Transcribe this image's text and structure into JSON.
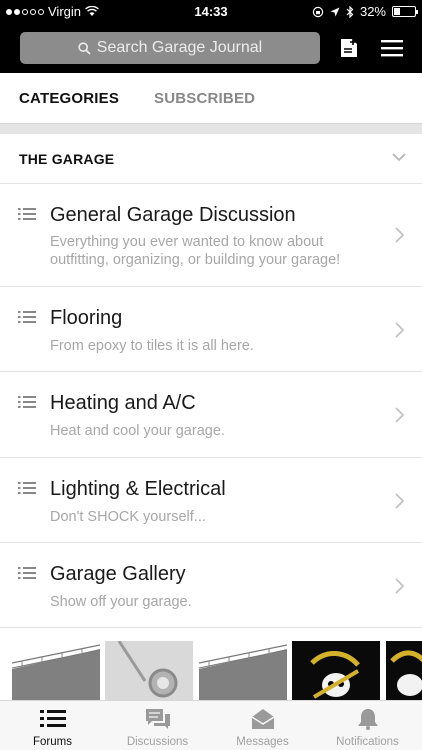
{
  "status_bar": {
    "carrier": "Virgin",
    "time": "14:33",
    "battery_percent": "32%",
    "battery_level": 0.32,
    "signal_strength_dots": 2
  },
  "header": {
    "search_placeholder": "Search Garage Journal",
    "icons": [
      "search-icon",
      "compose-icon",
      "menu-icon"
    ]
  },
  "tabs": [
    {
      "label": "CATEGORIES",
      "active": true
    },
    {
      "label": "SUBSCRIBED",
      "active": false
    }
  ],
  "section": {
    "title": "THE GARAGE"
  },
  "forums": [
    {
      "title": "General Garage Discussion",
      "description_lines": [
        "Everything you ever wanted to know about",
        "outfitting, organizing, or building your garage!"
      ]
    },
    {
      "title": "Flooring",
      "description_lines": [
        "From epoxy to tiles it is all here."
      ]
    },
    {
      "title": "Heating and A/C",
      "description_lines": [
        "Heat and cool your garage."
      ]
    },
    {
      "title": "Lighting & Electrical",
      "description_lines": [
        "Don't SHOCK yourself..."
      ]
    },
    {
      "title": "Garage Gallery",
      "description_lines": [
        "Show off your garage."
      ]
    }
  ],
  "bottom_tabs": [
    {
      "label": "Forums",
      "icon": "list-icon",
      "active": true
    },
    {
      "label": "Discussions",
      "icon": "chat-bubbles-icon",
      "active": false
    },
    {
      "label": "Messages",
      "icon": "envelope-icon",
      "active": false
    },
    {
      "label": "Notifications",
      "icon": "bell-icon",
      "active": false
    }
  ],
  "colors": {
    "header_background": "#000000",
    "search_background": "#8c8c8c",
    "muted_text": "#a7a7a7",
    "active_tab_label": "#111111"
  }
}
